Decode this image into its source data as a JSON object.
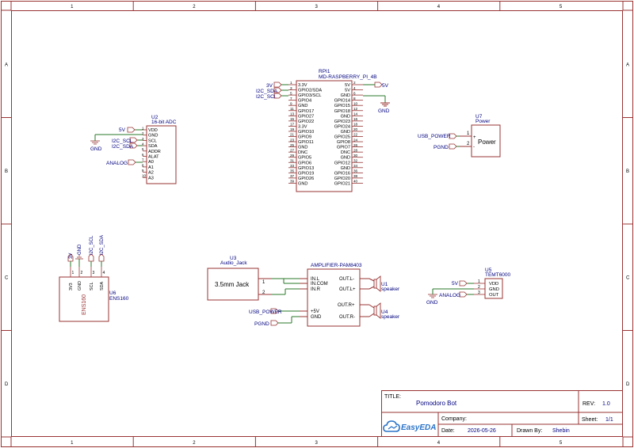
{
  "frame": {
    "cols": [
      "1",
      "2",
      "3",
      "4",
      "5"
    ],
    "rows": [
      "A",
      "B",
      "C",
      "D"
    ],
    "colors": {
      "border": "#993333",
      "body": "#993333",
      "wire": "#2a7a2a",
      "label": "#000080",
      "text": "#000000"
    }
  },
  "rpi": {
    "ref": "RPI1",
    "value": "MD-RASPBERRY_PI_4B",
    "left": [
      {
        "num": "1",
        "name": "3.3V"
      },
      {
        "num": "3",
        "name": "GPIO2/SDA"
      },
      {
        "num": "5",
        "name": "GPIO3/SCL"
      },
      {
        "num": "7",
        "name": "GPIO4"
      },
      {
        "num": "9",
        "name": "GND"
      },
      {
        "num": "11",
        "name": "GPIO17"
      },
      {
        "num": "13",
        "name": "GPIO27"
      },
      {
        "num": "15",
        "name": "GPIO22"
      },
      {
        "num": "17",
        "name": "3.3V"
      },
      {
        "num": "19",
        "name": "GPIO10"
      },
      {
        "num": "21",
        "name": "GPIO9"
      },
      {
        "num": "23",
        "name": "GPIO11"
      },
      {
        "num": "25",
        "name": "GND"
      },
      {
        "num": "27",
        "name": "DNC"
      },
      {
        "num": "29",
        "name": "GPIO5"
      },
      {
        "num": "31",
        "name": "GPIO6"
      },
      {
        "num": "33",
        "name": "GPIO13"
      },
      {
        "num": "35",
        "name": "GPIO19"
      },
      {
        "num": "37",
        "name": "GPIO26"
      },
      {
        "num": "39",
        "name": "GND"
      }
    ],
    "right": [
      {
        "num": "2",
        "name": "5V"
      },
      {
        "num": "4",
        "name": "5V"
      },
      {
        "num": "6",
        "name": "GND"
      },
      {
        "num": "8",
        "name": "GPIO14"
      },
      {
        "num": "10",
        "name": "GPIO15"
      },
      {
        "num": "12",
        "name": "GPIO18"
      },
      {
        "num": "14",
        "name": "GND"
      },
      {
        "num": "16",
        "name": "GPIO23"
      },
      {
        "num": "18",
        "name": "GPIO24"
      },
      {
        "num": "20",
        "name": "GND"
      },
      {
        "num": "22",
        "name": "GPIO25"
      },
      {
        "num": "24",
        "name": "GPIO8"
      },
      {
        "num": "26",
        "name": "GPIO7"
      },
      {
        "num": "28",
        "name": "DNC"
      },
      {
        "num": "30",
        "name": "GND"
      },
      {
        "num": "32",
        "name": "GPIO12"
      },
      {
        "num": "34",
        "name": "GND"
      },
      {
        "num": "36",
        "name": "GPIO16"
      },
      {
        "num": "38",
        "name": "GPIO20"
      },
      {
        "num": "40",
        "name": "GPIO21"
      }
    ],
    "flags": {
      "v3": "3V",
      "sda": "I2C_SDA",
      "scl": "I2C_SCL",
      "v5": "5V",
      "gnd": "GND"
    }
  },
  "adc": {
    "ref": "U2",
    "value": "16-bit ADC",
    "pins": [
      {
        "num": "1",
        "name": "VDD"
      },
      {
        "num": "2",
        "name": "GND"
      },
      {
        "num": "3",
        "name": "SCL"
      },
      {
        "num": "4",
        "name": "SDA"
      },
      {
        "num": "5",
        "name": "ADDR"
      },
      {
        "num": "6",
        "name": "ALAT"
      },
      {
        "num": "7",
        "name": "A0"
      },
      {
        "num": "8",
        "name": "A1"
      },
      {
        "num": "9",
        "name": "A2"
      },
      {
        "num": "10",
        "name": "A3"
      }
    ],
    "flags": {
      "v5": "5V",
      "gnd": "GND",
      "scl": "I2C_SCL",
      "sda": "I2C_SDA",
      "analog": "ANALOG"
    }
  },
  "power": {
    "ref": "U7",
    "value": "Power",
    "body": "Power",
    "pin1": "1",
    "pin2": "2",
    "plus": "+",
    "minus": "-",
    "usb": "USB_POWER",
    "pgnd": "PGND"
  },
  "ens": {
    "ref": "U6",
    "value": "ENS160",
    "body": "ENS160",
    "pins": [
      "3V3",
      "GND",
      "SCL",
      "SDA"
    ],
    "nums": [
      "1",
      "2",
      "3",
      "4"
    ],
    "flags": {
      "v3": "3V",
      "gnd": "GND",
      "scl": "I2C_SCL",
      "sda": "I2C_SDA"
    }
  },
  "audio": {
    "ref": "U3",
    "value": "Audio_Jack",
    "body": "3.5mm Jack",
    "p1": "1",
    "p2": "2"
  },
  "amp": {
    "value": "AMPLIFIER-PAM8403",
    "left": [
      "IN.L",
      "IN.COM",
      "IN.R",
      "+5V",
      "GND"
    ],
    "right": [
      "OUT.L-",
      "OUT.L+",
      "OUT.R+",
      "OUT.R-"
    ],
    "usb": "USB_POWER",
    "pgnd": "PGND"
  },
  "spk1": {
    "ref": "U1",
    "value": "speaker"
  },
  "spk4": {
    "ref": "U4",
    "value": "speaker"
  },
  "temt": {
    "ref": "U5",
    "value": "TEMT6000",
    "pins": [
      "VDD",
      "GND",
      "OUT"
    ],
    "nums": [
      "1",
      "2",
      "3"
    ],
    "flags": {
      "v5": "5V",
      "gnd": "GND",
      "analog": "ANALOG"
    }
  },
  "titleblock": {
    "title_label": "TITLE:",
    "title": "Pomodoro Bot",
    "rev_label": "REV:",
    "rev": "1.0",
    "company_label": "Company:",
    "sheet_label": "Sheet:",
    "sheet": "1/1",
    "date_label": "Date:",
    "date": "2026-05-26",
    "drawn_label": "Drawn By:",
    "drawn": "Shebin",
    "logo": "EasyEDA"
  }
}
